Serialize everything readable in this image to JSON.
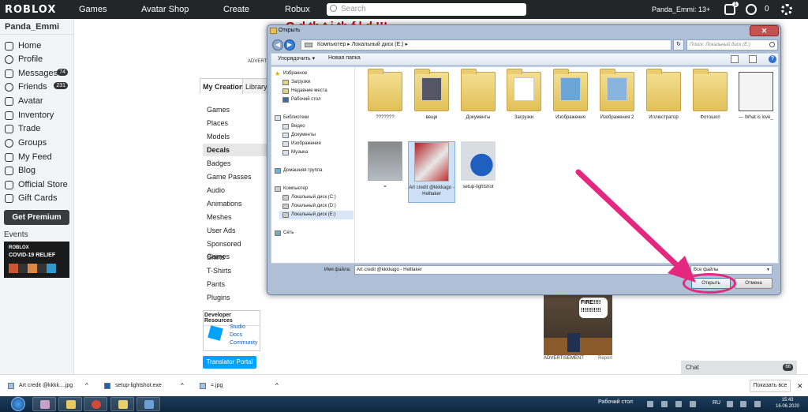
{
  "topbar": {
    "logo": "ROBLOX",
    "nav": [
      "Games",
      "Avatar Shop",
      "Create",
      "Robux"
    ],
    "search_placeholder": "Search",
    "username": "Panda_Emmi: 13+",
    "notifications": "1",
    "robux": "0"
  },
  "sidebar": {
    "username": "Panda_Emmi",
    "items": [
      {
        "label": "Home",
        "icon": "home-icon"
      },
      {
        "label": "Profile",
        "icon": "profile-icon"
      },
      {
        "label": "Messages",
        "icon": "messages-icon",
        "badge": "74"
      },
      {
        "label": "Friends",
        "icon": "friends-icon",
        "badge": "231"
      },
      {
        "label": "Avatar",
        "icon": "avatar-icon"
      },
      {
        "label": "Inventory",
        "icon": "inventory-icon"
      },
      {
        "label": "Trade",
        "icon": "trade-icon"
      },
      {
        "label": "Groups",
        "icon": "groups-icon"
      },
      {
        "label": "My Feed",
        "icon": "feed-icon"
      },
      {
        "label": "Blog",
        "icon": "blog-icon"
      },
      {
        "label": "Official Store",
        "icon": "store-icon"
      },
      {
        "label": "Gift Cards",
        "icon": "giftcard-icon"
      }
    ],
    "premium_label": "Get Premium",
    "events_label": "Events",
    "event_banner": {
      "brand": "ROBLOX",
      "title": "COVID-19 RELIEF"
    }
  },
  "page": {
    "heading": "G         d  th           t      i  th  f           l    d  !!!",
    "advert_label": "ADVERT",
    "tabs": [
      "My Creations",
      "Library"
    ],
    "categories": [
      "Games",
      "Places",
      "Models",
      "Decals",
      "Badges",
      "Game Passes",
      "Audio",
      "Animations",
      "Meshes",
      "User Ads",
      "Sponsored Games",
      "Shirts",
      "T-Shirts",
      "Pants",
      "Plugins"
    ],
    "active_category": "Decals",
    "dev_resources": {
      "title": "Developer Resources",
      "links": [
        "Studio",
        "Docs",
        "Community"
      ]
    },
    "translator_label": "Translator Portal",
    "ad": {
      "bubble": "FIRE!!!! !!!!!!!!!!!",
      "caption": "ADVERTISEMENT",
      "report": "Report"
    },
    "chat": {
      "label": "Chat",
      "badge": "66"
    }
  },
  "dialog": {
    "title": "Открыть",
    "path": [
      "Компьютер",
      "Локальный диск (E:)"
    ],
    "search_placeholder": "Поиск: Локальный диск (E:)",
    "organize_label": "Упорядочить ▾",
    "new_folder_label": "Новая папка",
    "nav": {
      "favorites": "Избранное",
      "favorites_items": [
        "Загрузки",
        "Недавние места",
        "Рабочий стол"
      ],
      "libraries": "Библиотеки",
      "library_items": [
        "Видео",
        "Документы",
        "Изображения",
        "Музыка"
      ],
      "homegroup": "Домашняя группа",
      "computer": "Компьютер",
      "drives": [
        "Локальный диск (C:)",
        "Локальный диск (D:)",
        "Локальный диск (E:)"
      ],
      "network": "Сеть"
    },
    "files": [
      {
        "name": "???????",
        "kind": "folder"
      },
      {
        "name": "вещи",
        "kind": "folder"
      },
      {
        "name": "Документы",
        "kind": "folder"
      },
      {
        "name": "Загрузки",
        "kind": "folder"
      },
      {
        "name": "Изображения",
        "kind": "folder"
      },
      {
        "name": "Изображения 2",
        "kind": "folder"
      },
      {
        "name": "Иллюстратор",
        "kind": "folder"
      },
      {
        "name": "Фотошоп",
        "kind": "folder"
      },
      {
        "name": "— What is love_",
        "kind": "image"
      },
      {
        "name": "=",
        "kind": "image"
      },
      {
        "name": "Art credit @kkkkago - Helltaker",
        "kind": "image",
        "selected": true
      },
      {
        "name": "setup-lightshot",
        "kind": "installer"
      }
    ],
    "filename_label": "Имя файла:",
    "filename_value": "Art credit @kkkkago - Helltaker",
    "filetype": "Все файлы",
    "open_label": "Открыть",
    "cancel_label": "Отмена"
  },
  "downloads": {
    "items": [
      "Art credit @kkkk....jpg",
      "setup-lightshot.exe",
      "=.jpg"
    ],
    "show_all": "Показать все"
  },
  "taskbar": {
    "desktop_label": "Рабочий стол",
    "lang": "RU",
    "time": "15:43",
    "date": "16.06.2020"
  },
  "colors": {
    "accent_blue": "#00a2ff",
    "topbar": "#232527",
    "annotation_pink": "#e4287f"
  }
}
